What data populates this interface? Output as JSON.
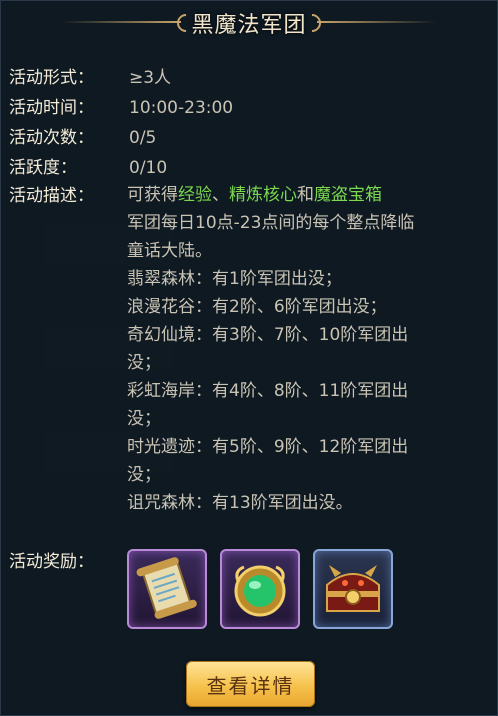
{
  "title": "黑魔法军团",
  "rows": [
    {
      "label": "活动形式：",
      "value": "≥3人"
    },
    {
      "label": "活动时间：",
      "value": "10:00-23:00"
    },
    {
      "label": "活动次数：",
      "value": "0/5"
    },
    {
      "label": "活跃度：",
      "value": "0/10"
    }
  ],
  "description": {
    "label": "活动描述：",
    "intro_prefix": "可获得",
    "reward_1": "经验",
    "sep_1": "、",
    "reward_2": "精炼核心",
    "sep_2": "和",
    "reward_3": "魔盗宝箱",
    "lines": [
      "军团每日10点-23点间的每个整点降临",
      "童话大陆。",
      "翡翠森林：有1阶军团出没；",
      "浪漫花谷：有2阶、6阶军团出没；",
      "奇幻仙境：有3阶、7阶、10阶军团出",
      "没；",
      "彩虹海岸：有4阶、8阶、11阶军团出",
      "没；",
      "时光遗迹：有5阶、9阶、12阶军团出",
      "没；",
      "诅咒森林：有13阶军团出没。"
    ]
  },
  "rewards": {
    "label": "活动奖励：",
    "items": [
      {
        "icon": "scroll-icon",
        "frame": "purple"
      },
      {
        "icon": "green-gem-icon",
        "frame": "purple"
      },
      {
        "icon": "treasure-chest-icon",
        "frame": "blue"
      }
    ]
  },
  "detail_button": "查看详情",
  "colors": {
    "highlight": "#7bd84f",
    "button": "#f6c24c"
  }
}
